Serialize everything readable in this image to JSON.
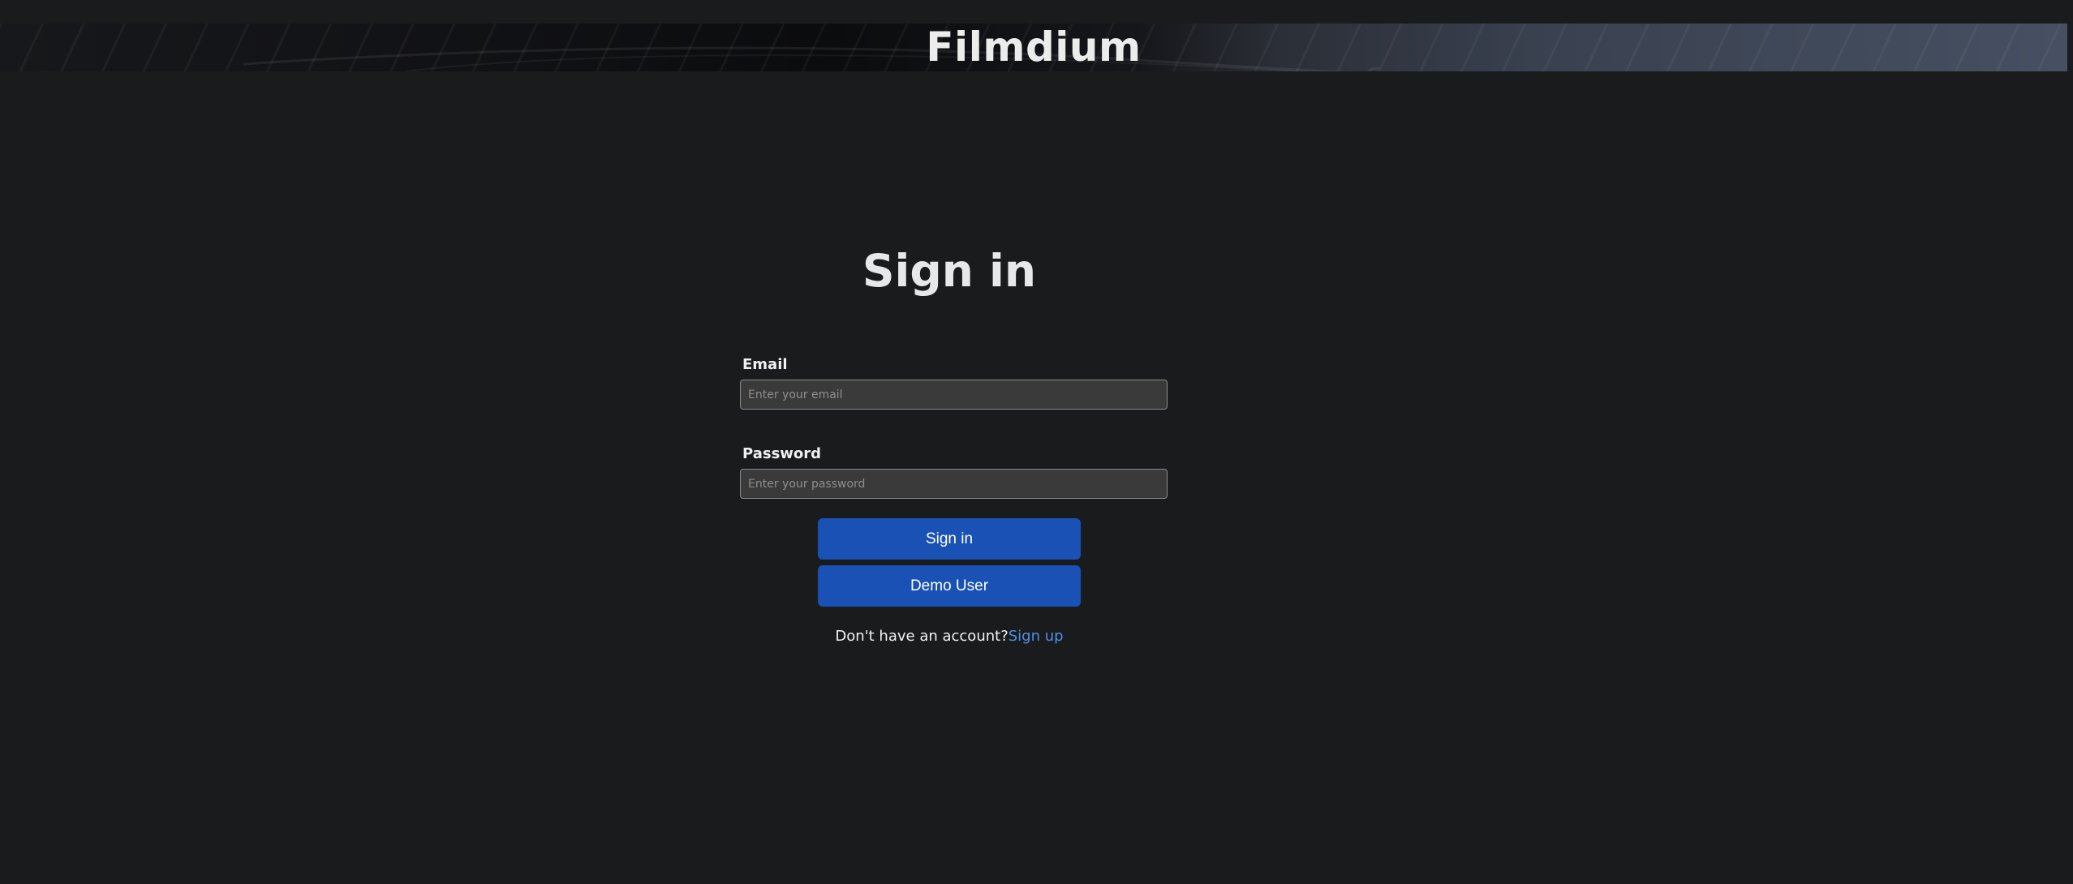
{
  "header": {
    "brand": "Filmdium"
  },
  "signin": {
    "title": "Sign in",
    "email": {
      "label": "Email",
      "placeholder": "Enter your email",
      "value": ""
    },
    "password": {
      "label": "Password",
      "placeholder": "Enter your password",
      "value": ""
    },
    "signin_button": "Sign in",
    "demo_button": "Demo User",
    "no_account_text": "Don't have an account?",
    "signup_link": "Sign up"
  },
  "colors": {
    "background": "#1a1b1d",
    "button": "#1a51b5",
    "link": "#4f8fe6"
  }
}
